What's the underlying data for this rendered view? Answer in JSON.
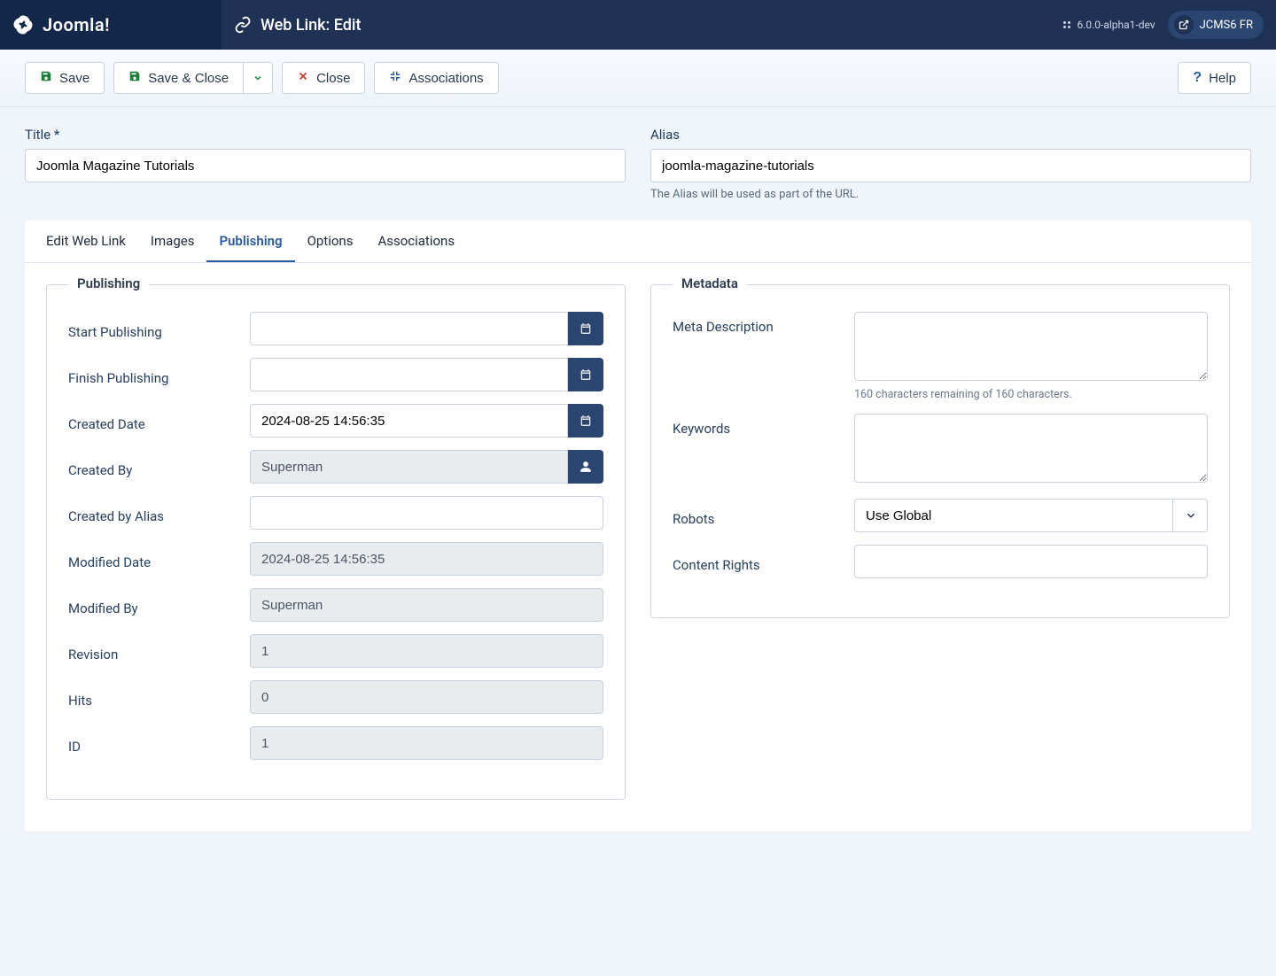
{
  "brand": "Joomla!",
  "page_title": "Web Link: Edit",
  "version": "6.0.0-alpha1-dev",
  "site_badge": "JCMS6 FR",
  "toolbar": {
    "save": "Save",
    "save_close": "Save & Close",
    "close": "Close",
    "associations": "Associations",
    "help": "Help"
  },
  "fields": {
    "title_label": "Title *",
    "title_value": "Joomla Magazine Tutorials",
    "alias_label": "Alias",
    "alias_value": "joomla-magazine-tutorials",
    "alias_hint": "The Alias will be used as part of the URL."
  },
  "tabs": {
    "edit": "Edit Web Link",
    "images": "Images",
    "publishing": "Publishing",
    "options": "Options",
    "associations": "Associations"
  },
  "publishing": {
    "legend": "Publishing",
    "start_label": "Start Publishing",
    "start_value": "",
    "finish_label": "Finish Publishing",
    "finish_value": "",
    "created_label": "Created Date",
    "created_value": "2024-08-25 14:56:35",
    "createdby_label": "Created By",
    "createdby_value": "Superman",
    "createdbyalias_label": "Created by Alias",
    "createdbyalias_value": "",
    "modified_label": "Modified Date",
    "modified_value": "2024-08-25 14:56:35",
    "modifiedby_label": "Modified By",
    "modifiedby_value": "Superman",
    "revision_label": "Revision",
    "revision_value": "1",
    "hits_label": "Hits",
    "hits_value": "0",
    "id_label": "ID",
    "id_value": "1"
  },
  "metadata": {
    "legend": "Metadata",
    "desc_label": "Meta Description",
    "desc_counter": "160 characters remaining of 160 characters.",
    "keywords_label": "Keywords",
    "robots_label": "Robots",
    "robots_value": "Use Global",
    "rights_label": "Content Rights"
  }
}
